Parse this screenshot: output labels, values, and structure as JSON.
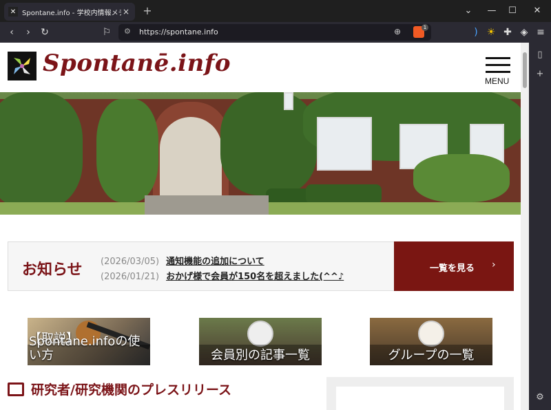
{
  "browser": {
    "tab_title": "Spontane.info - 学校内情報メディ",
    "url": "https://spontane.info",
    "shield_count": "1"
  },
  "site": {
    "logo_text": "Spontanē.info",
    "menu_label": "MENU"
  },
  "notice": {
    "title": "お知らせ",
    "items": [
      {
        "date": "(2026/03/05)",
        "text": "通知機能の追加について"
      },
      {
        "date": "(2026/01/21)",
        "text": "おかげ様で会員が150名を超えました(^^♪"
      }
    ],
    "button_label": "一覧を見る",
    "button_arrow": "›"
  },
  "cards": [
    {
      "line1": "【取説】",
      "line2": "Spontane.infoの使い方"
    },
    {
      "line1": "",
      "line2": "会員別の記事一覧"
    },
    {
      "line1": "",
      "line2": "グループの一覧"
    }
  ],
  "section": {
    "title": "研究者/研究機関のプレスリリース"
  },
  "colors": {
    "brand": "#7b1418",
    "button": "#7a1612"
  }
}
